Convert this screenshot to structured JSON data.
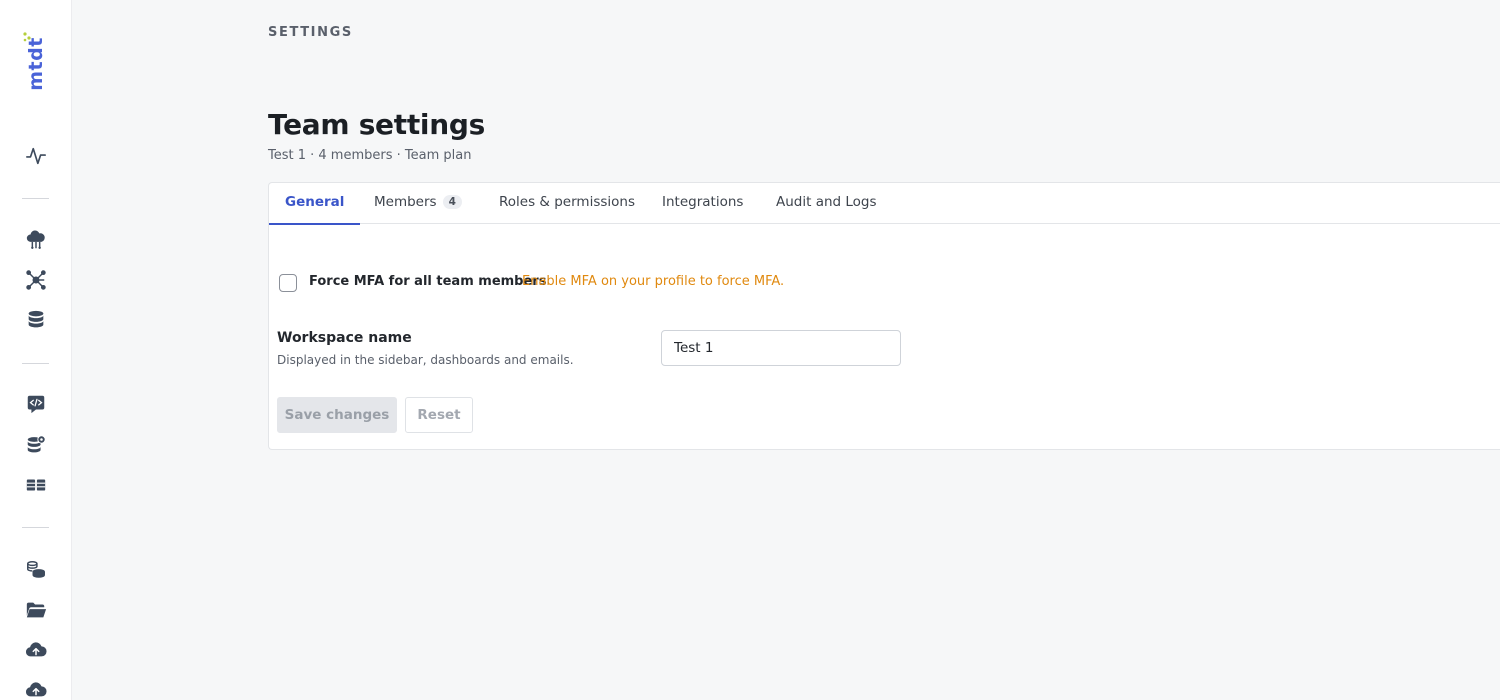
{
  "app": {
    "logo_text": "mtdt",
    "brand_color": "#4a63d8"
  },
  "sidebar": {
    "icons": [
      {
        "name": "activity-icon"
      },
      {
        "name": "cloud-network-icon"
      },
      {
        "name": "graph-nodes-icon"
      },
      {
        "name": "database-stack-icon"
      },
      {
        "name": "code-chat-icon"
      },
      {
        "name": "database-settings-icon"
      },
      {
        "name": "tables-icon"
      },
      {
        "name": "coins-stack-icon"
      },
      {
        "name": "folder-open-icon"
      },
      {
        "name": "cloud-upload-icon"
      },
      {
        "name": "cloud-upload-icon-2"
      }
    ]
  },
  "header": {
    "section_label": "SETTINGS",
    "title": "Team settings",
    "subtitle": "Test 1 · 4 members · Team plan"
  },
  "tabs": [
    {
      "label": "General",
      "active": true
    },
    {
      "label": "Members",
      "badge": "4"
    },
    {
      "label": "Roles & permissions"
    },
    {
      "label": "Integrations"
    },
    {
      "label": "Audit and Logs"
    }
  ],
  "mfa": {
    "label": "Force MFA for all team members",
    "hint": "Enable MFA on your profile to force MFA.",
    "checked": false,
    "hint_color": "#e0890f"
  },
  "workspace": {
    "title": "Workspace name",
    "description": "Displayed in the sidebar, dashboards and emails.",
    "value": "Test 1"
  },
  "actions": {
    "save_label": "Save changes",
    "reset_label": "Reset"
  }
}
